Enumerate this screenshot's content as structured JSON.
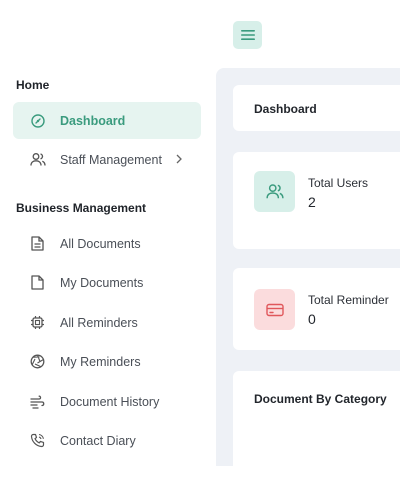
{
  "topbar": {
    "menu_icon": "hamburger-icon"
  },
  "sidebar": {
    "home_section": "Home",
    "business_section": "Business Management",
    "items": [
      {
        "label": "Dashboard",
        "icon": "dashboard-gauge-icon",
        "active": true
      },
      {
        "label": "Staff Management",
        "icon": "users-icon",
        "has_submenu": true
      },
      {
        "label": "All Documents",
        "icon": "document-lines-icon"
      },
      {
        "label": "My Documents",
        "icon": "document-icon"
      },
      {
        "label": "All Reminders",
        "icon": "chip-icon"
      },
      {
        "label": "My Reminders",
        "icon": "aperture-icon"
      },
      {
        "label": "Document History",
        "icon": "history-wind-icon"
      },
      {
        "label": "Contact Diary",
        "icon": "phone-icon"
      }
    ]
  },
  "main": {
    "header_title": "Dashboard",
    "stats": [
      {
        "label": "Total Users",
        "value": "2",
        "icon": "users-icon",
        "color": "#3a9b7e",
        "bg": "#d7efe9"
      },
      {
        "label": "Total Reminder",
        "value": "0",
        "icon": "credit-card-icon",
        "color": "#e0575b",
        "bg": "#fbdcdd"
      }
    ],
    "category_title": "Document By Category"
  },
  "colors": {
    "accent": "#3a9b7e",
    "content_bg": "#eef1f6"
  }
}
